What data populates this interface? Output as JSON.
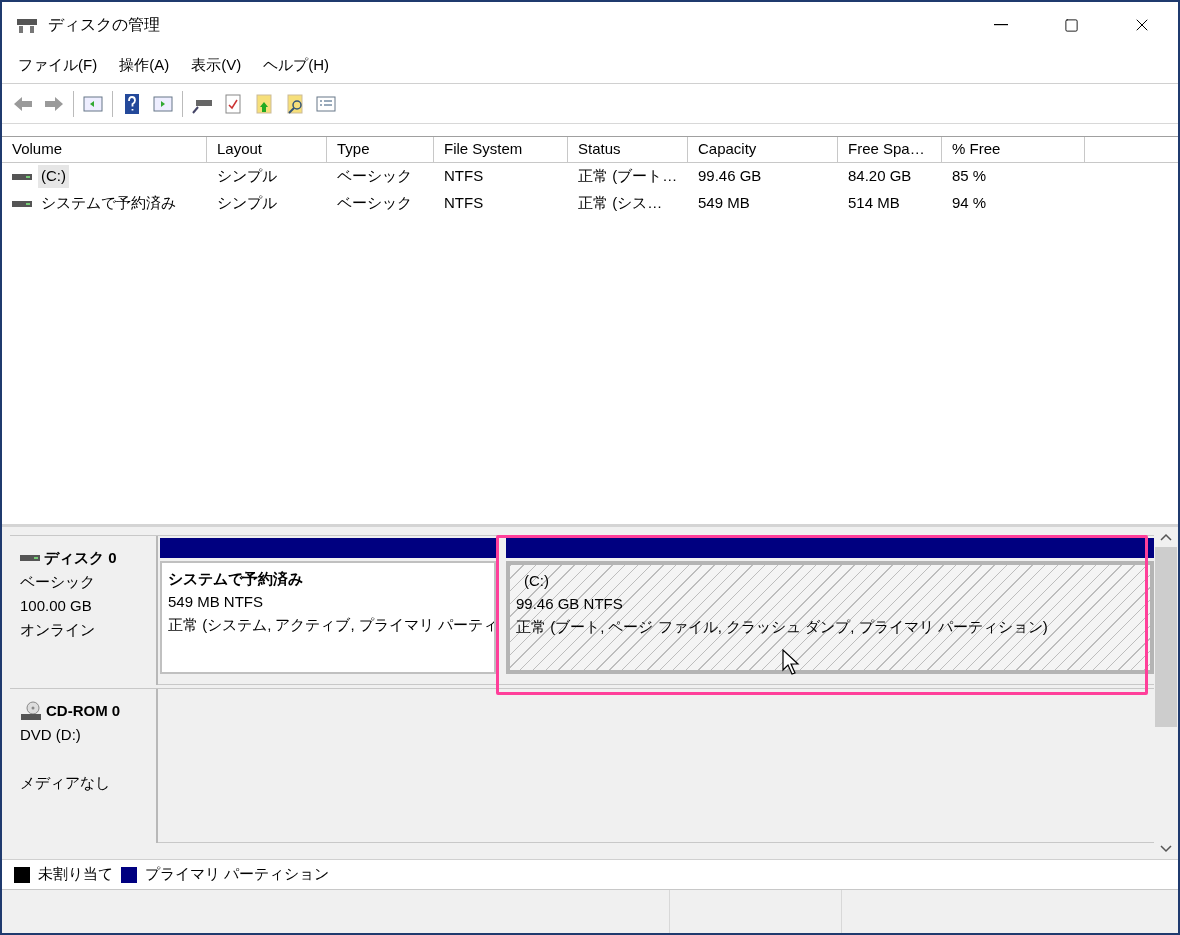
{
  "window": {
    "title": "ディスクの管理"
  },
  "menu": [
    "ファイル(F)",
    "操作(A)",
    "表示(V)",
    "ヘルプ(H)"
  ],
  "table": {
    "columns": [
      "Volume",
      "Layout",
      "Type",
      "File System",
      "Status",
      "Capacity",
      "Free Spa…",
      "% Free"
    ],
    "rows": [
      {
        "selected": true,
        "cells": [
          "(C:)",
          "シンプル",
          "ベーシック",
          "NTFS",
          "正常 (ブート…",
          "99.46 GB",
          "84.20 GB",
          "85 %"
        ]
      },
      {
        "selected": false,
        "cells": [
          "システムで予約済み",
          "シンプル",
          "ベーシック",
          "NTFS",
          "正常 (シス…",
          "549 MB",
          "514 MB",
          "94 %"
        ]
      }
    ]
  },
  "disks": [
    {
      "kind": "disk",
      "name": "ディスク 0",
      "type": "ベーシック",
      "size": "100.00 GB",
      "state": "オンライン",
      "partitions": [
        {
          "name": "システムで予約済み",
          "size": "549 MB NTFS",
          "status": "正常 (システム, アクティブ, プライマリ パーティ",
          "selected": false
        },
        {
          "name": "(C:)",
          "size": "99.46 GB NTFS",
          "status": "正常 (ブート, ページ ファイル, クラッシュ ダンプ, プライマリ パーティション)",
          "selected": true
        }
      ]
    },
    {
      "kind": "cdrom",
      "name": "CD-ROM 0",
      "type": "DVD (D:)",
      "state": "メディアなし"
    }
  ],
  "legend": [
    {
      "label": "未割り当て",
      "color": "#000000"
    },
    {
      "label": "プライマリ パーティション",
      "color": "#000080"
    }
  ]
}
